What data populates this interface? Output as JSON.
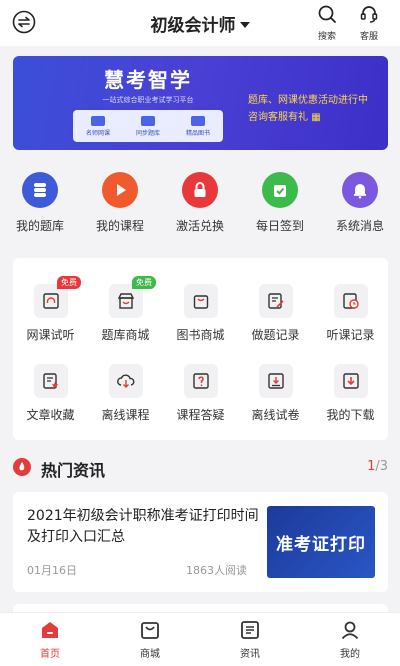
{
  "header": {
    "title": "初级会计师",
    "search_label": "搜索",
    "service_label": "客服"
  },
  "banner": {
    "brand": "慧考智学",
    "subtitle": "一站式综合职业考试学习平台",
    "tabs": [
      "名师网课",
      "同步题库",
      "精品图书"
    ],
    "promo_line1": "题库、网课优惠活动进行中",
    "promo_line2": "咨询客服有礼"
  },
  "quick": [
    {
      "label": "我的题库",
      "icon": "question-bank-icon",
      "color": "#3d5bd9"
    },
    {
      "label": "我的课程",
      "icon": "play-icon",
      "color": "#f05a2c"
    },
    {
      "label": "激活兑换",
      "icon": "lock-icon",
      "color": "#e8383c"
    },
    {
      "label": "每日签到",
      "icon": "check-bag-icon",
      "color": "#3dbb4a"
    },
    {
      "label": "系统消息",
      "icon": "bell-icon",
      "color": "#7a58e0"
    }
  ],
  "grid": {
    "row1": [
      {
        "label": "网课试听",
        "badge": "免费",
        "badge_color": "#e8383c"
      },
      {
        "label": "题库商城",
        "badge": "免费",
        "badge_color": "#3dbb4a"
      },
      {
        "label": "图书商城",
        "badge": ""
      },
      {
        "label": "做题记录",
        "badge": ""
      },
      {
        "label": "听课记录",
        "badge": ""
      }
    ],
    "row2": [
      {
        "label": "文章收藏"
      },
      {
        "label": "离线课程"
      },
      {
        "label": "课程答疑"
      },
      {
        "label": "离线试卷"
      },
      {
        "label": "我的下载"
      }
    ]
  },
  "news": {
    "section_title": "热门资讯",
    "page_current": "1",
    "page_total": "/3",
    "items": [
      {
        "title": "2021年初级会计职称准考证打印时间及打印入口汇总",
        "date": "01月16日",
        "views": "1863人阅读",
        "thumb_text": "准考证打印"
      }
    ]
  },
  "nav": [
    {
      "label": "首页",
      "active": true
    },
    {
      "label": "商城",
      "active": false
    },
    {
      "label": "资讯",
      "active": false
    },
    {
      "label": "我的",
      "active": false
    }
  ],
  "colors": {
    "accent": "#e43b3b",
    "banner": "#3b4fd8"
  }
}
